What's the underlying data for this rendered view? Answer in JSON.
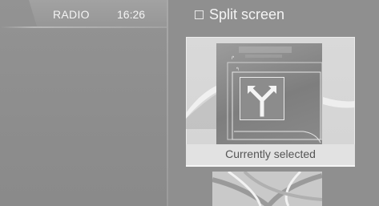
{
  "status_bar": {
    "source": "RADIO",
    "time": "16:26"
  },
  "split_screen": {
    "label": "Split screen",
    "checked": false
  },
  "selected_card": {
    "caption": "Currently selected"
  },
  "icons": {
    "checkbox": "checkbox-unchecked-icon",
    "navigation": "fork-arrow-icon",
    "thumbnail": "map-thumbnail"
  },
  "colors": {
    "background": "#8e8e8e",
    "card": "#d9d9d9",
    "text": "#f4f4f4",
    "caption_text": "#555555"
  }
}
